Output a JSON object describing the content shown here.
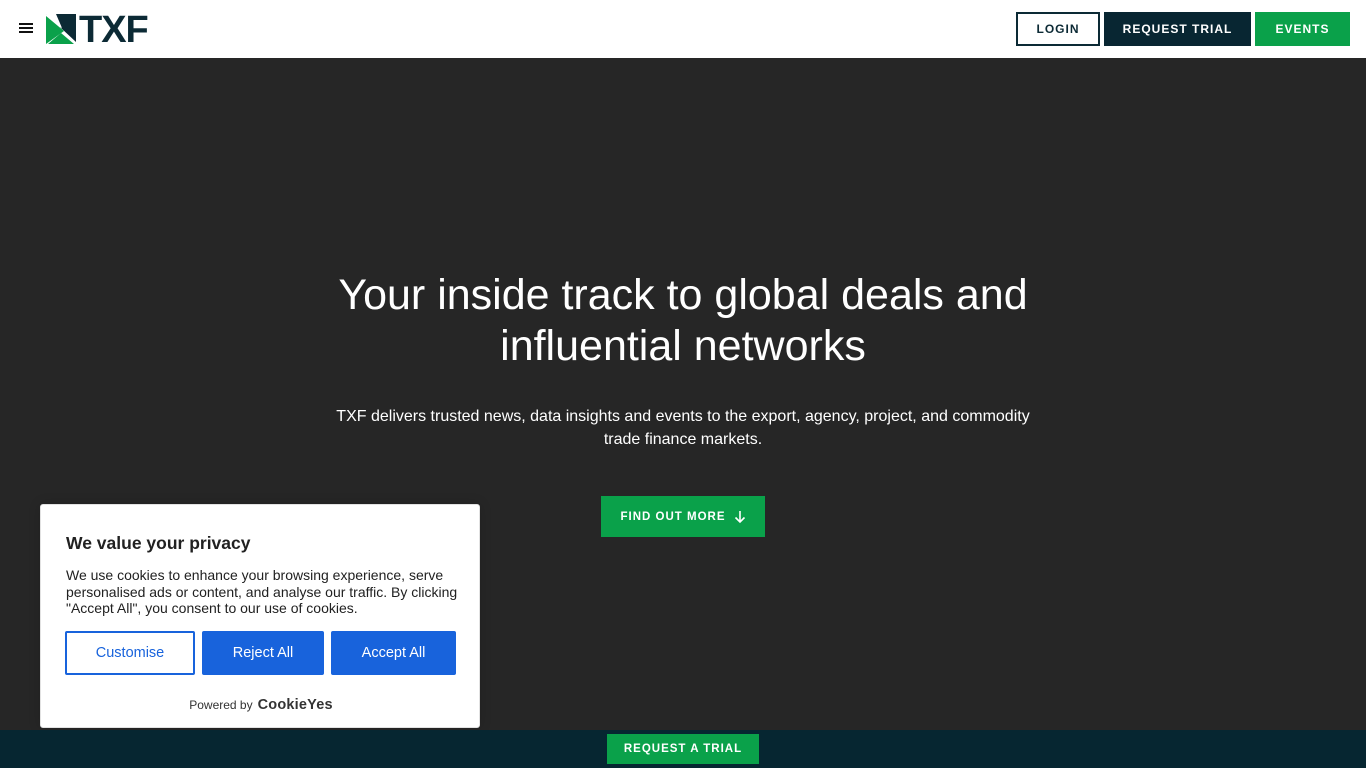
{
  "header": {
    "logo_text": "TXF",
    "login_label": "LOGIN",
    "request_trial_label": "REQUEST TRIAL",
    "events_label": "EVENTS"
  },
  "hero": {
    "title": "Your inside track to global deals and influential networks",
    "subtitle": "TXF delivers trusted news, data insights and events to the export, agency, project, and commodity trade finance markets.",
    "cta_label": "FIND OUT MORE"
  },
  "cookie_banner": {
    "title": "We value your privacy",
    "text": "We use cookies to enhance your browsing experience, serve personalised ads or content, and analyse our traffic. By clicking \"Accept All\", you consent to our use of cookies.",
    "customise_label": "Customise",
    "reject_label": "Reject All",
    "accept_label": "Accept All",
    "powered_by_label": "Powered by",
    "powered_by_brand": "CookieYes"
  },
  "bottom_bar": {
    "cta_label": "REQUEST A TRIAL"
  },
  "icons": {
    "menu": "hamburger-menu-icon",
    "arrow": "arrow-down-icon"
  },
  "colors": {
    "brand_green": "#0aa14a",
    "brand_navy": "#082632",
    "hero_bg": "#262626",
    "cookie_blue": "#1863dc"
  }
}
